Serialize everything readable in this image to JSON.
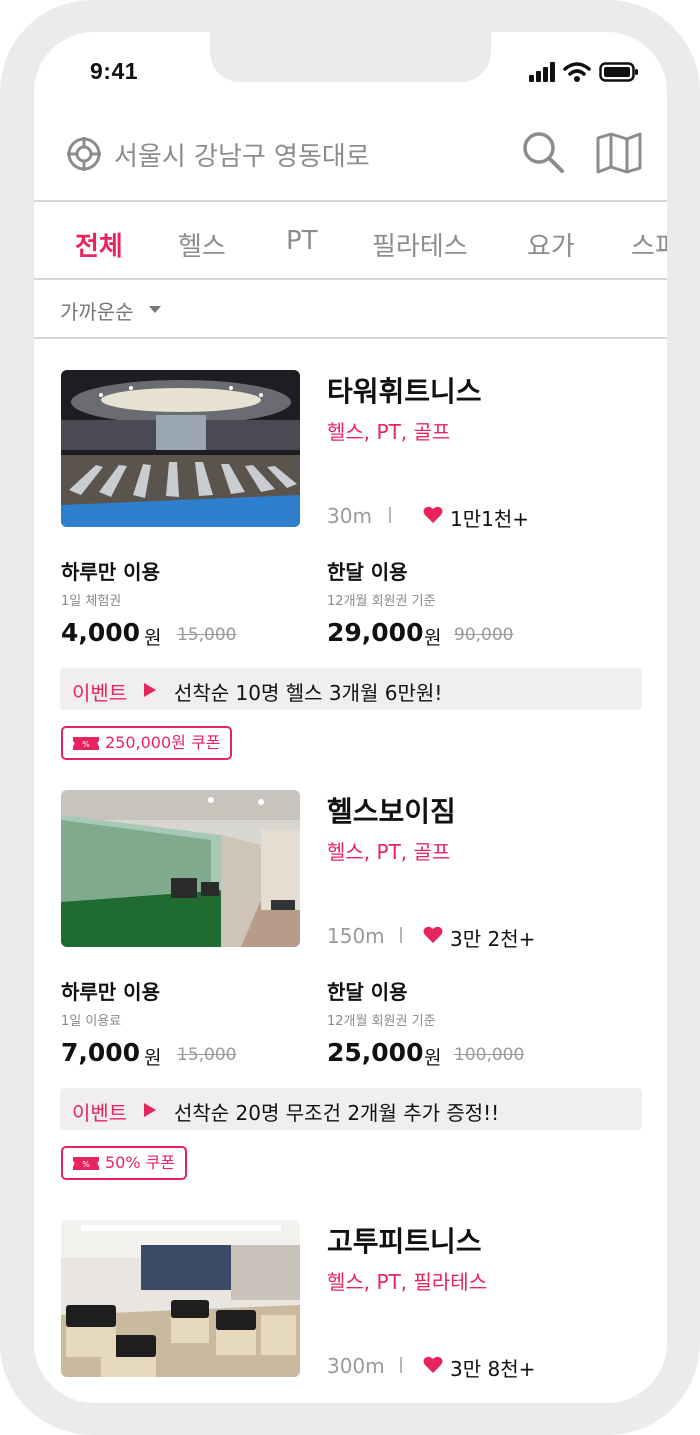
{
  "status": {
    "time": "9:41"
  },
  "search": {
    "location": "서울시 강남구 영동대로"
  },
  "tabs": [
    {
      "label": "전체",
      "active": true
    },
    {
      "label": "헬스",
      "active": false
    },
    {
      "label": "PT",
      "active": false
    },
    {
      "label": "필라테스",
      "active": false
    },
    {
      "label": "요가",
      "active": false
    },
    {
      "label": "스피",
      "active": false
    }
  ],
  "sort": {
    "label": "가까운순"
  },
  "colors": {
    "accent": "#e8245f",
    "muted": "#8c8c8c",
    "divider": "#d6d6d6",
    "event_bg": "#f0eeee"
  },
  "gyms": [
    {
      "name": "타워휘트니스",
      "categories": "헬스, PT, 골프",
      "distance": "30m",
      "likes": "1만1천+",
      "day_pass": {
        "title": "하루만 이용",
        "sub": "1일 체험권",
        "price": "4,000",
        "unit": "원",
        "original": "15,000"
      },
      "month_pass": {
        "title": "한달 이용",
        "sub": "12개월 회원권 기준",
        "price": "29,000",
        "unit": "원",
        "original": "90,000"
      },
      "event": {
        "label": "이벤트",
        "text": "선착순 10명 헬스 3개월 6만원!"
      },
      "coupon": "250,000원 쿠폰"
    },
    {
      "name": "헬스보이짐",
      "categories": "헬스, PT, 골프",
      "distance": "150m",
      "likes": "3만 2천+",
      "day_pass": {
        "title": "하루만 이용",
        "sub": "1일 이용료",
        "price": "7,000",
        "unit": "원",
        "original": "15,000"
      },
      "month_pass": {
        "title": "한달 이용",
        "sub": "12개월 회원권 기준",
        "price": "25,000",
        "unit": "원",
        "original": "100,000"
      },
      "event": {
        "label": "이벤트",
        "text": "선착순 20명 무조건 2개월 추가 증정!!"
      },
      "coupon": "50% 쿠폰"
    },
    {
      "name": "고투피트니스",
      "categories": "헬스, PT, 필라테스",
      "distance": "300m",
      "likes": "3만 8천+"
    }
  ]
}
